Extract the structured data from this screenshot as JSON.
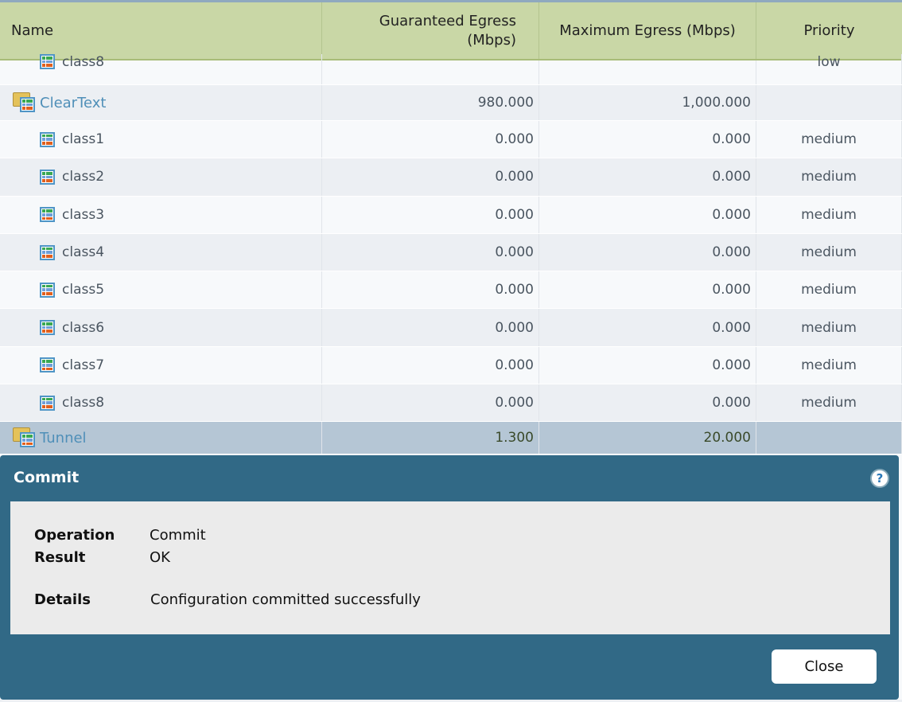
{
  "columns": [
    "Name",
    "Guaranteed Egress (Mbps)",
    "Maximum Egress (Mbps)",
    "Priority"
  ],
  "partial_row": {
    "name": "class8",
    "priority": "low"
  },
  "groups": [
    {
      "name": "ClearText",
      "guaranteed": "980.000",
      "maximum": "1,000.000",
      "classes": [
        {
          "name": "class1",
          "guaranteed": "0.000",
          "maximum": "0.000",
          "priority": "medium"
        },
        {
          "name": "class2",
          "guaranteed": "0.000",
          "maximum": "0.000",
          "priority": "medium"
        },
        {
          "name": "class3",
          "guaranteed": "0.000",
          "maximum": "0.000",
          "priority": "medium"
        },
        {
          "name": "class4",
          "guaranteed": "0.000",
          "maximum": "0.000",
          "priority": "medium"
        },
        {
          "name": "class5",
          "guaranteed": "0.000",
          "maximum": "0.000",
          "priority": "medium"
        },
        {
          "name": "class6",
          "guaranteed": "0.000",
          "maximum": "0.000",
          "priority": "medium"
        },
        {
          "name": "class7",
          "guaranteed": "0.000",
          "maximum": "0.000",
          "priority": "medium"
        },
        {
          "name": "class8",
          "guaranteed": "0.000",
          "maximum": "0.000",
          "priority": "medium"
        }
      ]
    },
    {
      "name": "Tunnel",
      "guaranteed": "1.300",
      "maximum": "20.000"
    }
  ],
  "dialog": {
    "title": "Commit",
    "help": "?",
    "operation_label": "Operation",
    "operation": "Commit",
    "result_label": "Result",
    "result": "OK",
    "details_label": "Details",
    "details": "Configuration committed successfully",
    "close": "Close"
  }
}
